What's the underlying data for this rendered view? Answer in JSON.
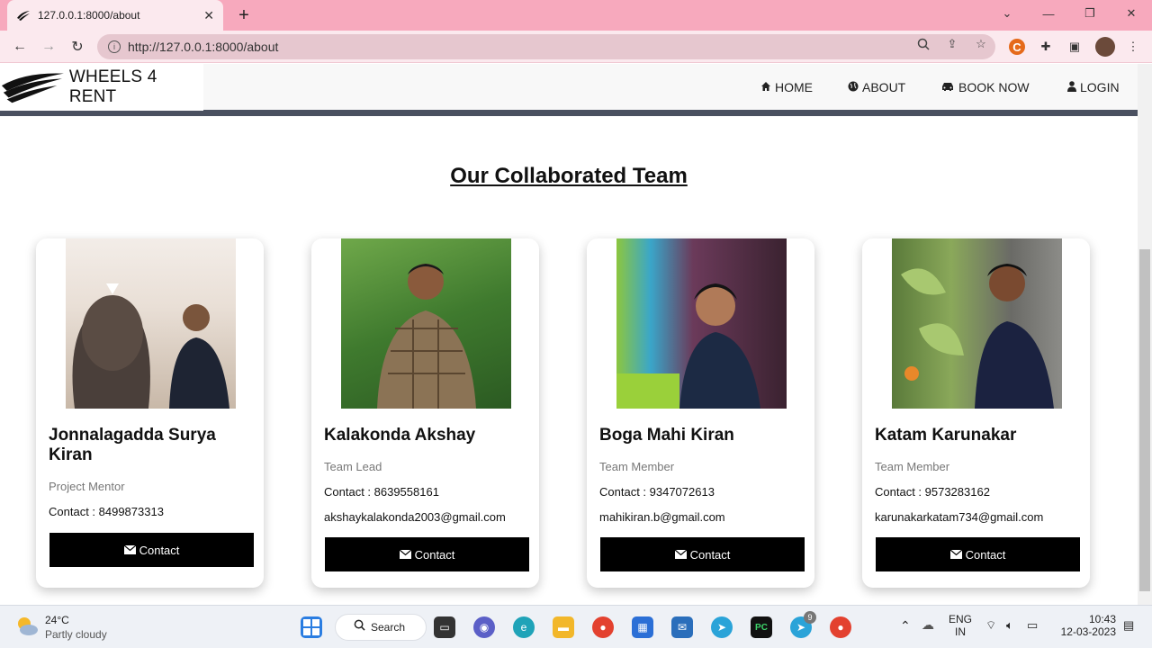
{
  "browser": {
    "tab_title": "127.0.0.1:8000/about",
    "url": "http://127.0.0.1:8000/about"
  },
  "site": {
    "brand": "WHEELS 4 RENT",
    "nav": [
      {
        "label": "HOME",
        "icon": "home-icon"
      },
      {
        "label": "ABOUT",
        "icon": "globe-icon"
      },
      {
        "label": "BOOK NOW",
        "icon": "car-icon"
      },
      {
        "label": "LOGIN",
        "icon": "user-icon"
      }
    ],
    "heading": "Our Collaborated Team"
  },
  "team": [
    {
      "name": "Jonnalagadda Surya Kiran",
      "role": "Project Mentor",
      "contact": "Contact : 8499873313",
      "email": "",
      "button": "Contact"
    },
    {
      "name": "Kalakonda Akshay",
      "role": "Team Lead",
      "contact": "Contact : 8639558161",
      "email": "akshaykalakonda2003@gmail.com",
      "button": "Contact"
    },
    {
      "name": "Boga Mahi Kiran",
      "role": "Team Member",
      "contact": "Contact : 9347072613",
      "email": "mahikiran.b@gmail.com",
      "button": "Contact"
    },
    {
      "name": "Katam Karunakar",
      "role": "Team Member",
      "contact": "Contact : 9573283162",
      "email": "karunakarkatam734@gmail.com",
      "button": "Contact"
    }
  ],
  "taskbar": {
    "temp": "24°C",
    "weather": "Partly cloudy",
    "search": "Search",
    "lang1": "ENG",
    "lang2": "IN",
    "time": "10:43",
    "date": "12-03-2023",
    "telegram_badge": "9"
  },
  "colors": {
    "tab_strip": "#f7a9bd",
    "toolbar": "#fbe9ee",
    "nav_border": "#4a5060",
    "button": "#000000"
  }
}
